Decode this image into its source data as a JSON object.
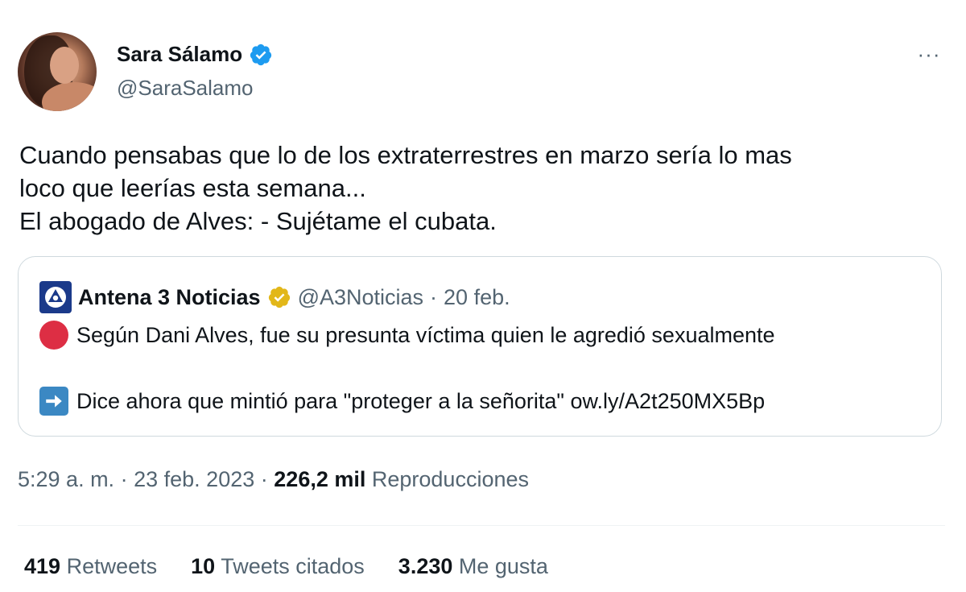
{
  "author": {
    "name": "Sara Sálamo",
    "handle": "@SaraSalamo",
    "verified_color": "#1d9bf0"
  },
  "more_label": "···",
  "tweet_text": [
    "Cuando pensabas que lo de los extraterrestres en marzo sería lo mas",
    "loco que leerías esta semana...",
    "El abogado de Alves: - Sujétame el cubata."
  ],
  "quote": {
    "name": "Antena 3 Noticias",
    "handle": "@A3Noticias",
    "separator": "·",
    "date": "20 feb.",
    "verified_color": "#e2b719",
    "line1_icon": "red-circle-icon",
    "line1": "Según Dani Alves, fue su presunta víctima quien le agredió sexualmente",
    "line2_icon": "right-arrow-icon",
    "line2": "Dice ahora que mintió para \"proteger a la señorita\" ow.ly/A2t250MX5Bp"
  },
  "meta": {
    "time": "5:29 a. m.",
    "sep1": "·",
    "date": "23 feb. 2023",
    "sep2": "·",
    "views_count": "226,2 mil",
    "views_label": "Reproducciones"
  },
  "stats": {
    "retweets_count": "419",
    "retweets_label": "Retweets",
    "quotes_count": "10",
    "quotes_label": "Tweets citados",
    "likes_count": "3.230",
    "likes_label": "Me gusta"
  }
}
